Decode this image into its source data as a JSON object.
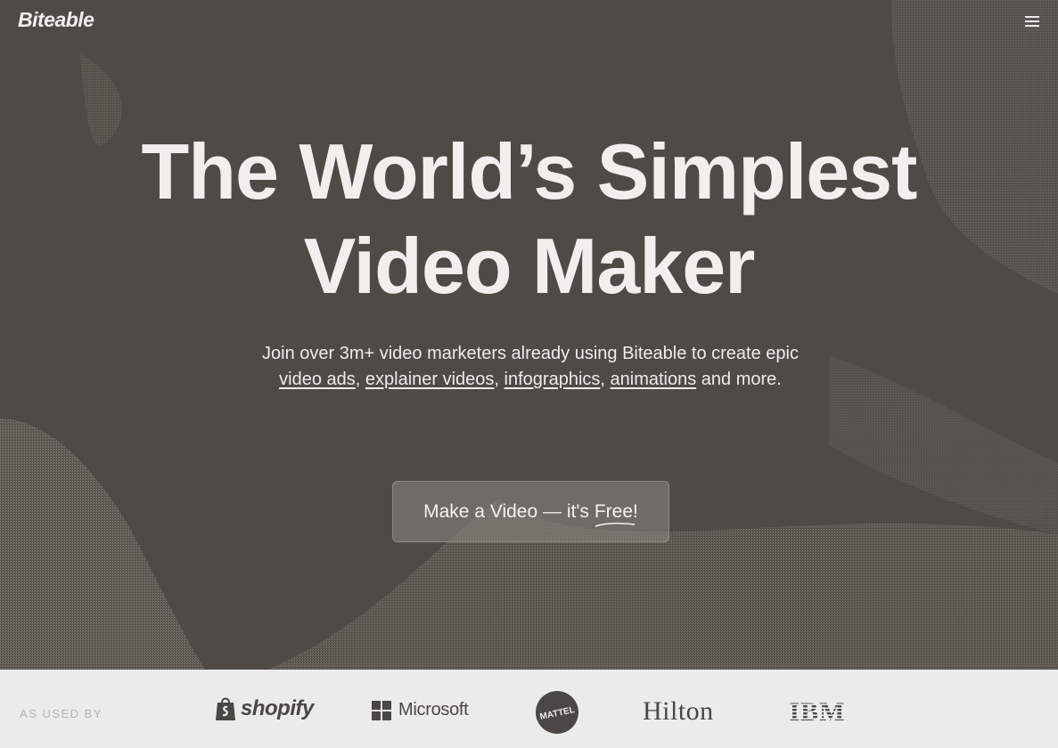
{
  "header": {
    "logo_text": "Biteable",
    "menu_icon": "hamburger-menu-icon"
  },
  "hero": {
    "headline_line1": "The World’s Simplest",
    "headline_line2": "Video Maker",
    "subtext": {
      "intro": "Join over 3m+ video marketers already using Biteable to create epic ",
      "link_video_ads": "video ads",
      "sep1": ", ",
      "link_explainer_videos": "explainer videos",
      "sep2": ", ",
      "link_infographics": "infographics",
      "sep3": ", ",
      "link_animations": "animations",
      "outro": " and more."
    },
    "cta": {
      "label_main": "Make a Video — it's",
      "label_free": "Free!"
    },
    "colors": {
      "background": "#4e4a45",
      "text": "#f1efed"
    }
  },
  "logos_bar": {
    "label": "AS USED BY",
    "brands": {
      "shopify": "shopify",
      "microsoft": "Microsoft",
      "mattel": "MATTEL",
      "hilton": "Hilton",
      "ibm": "IBM"
    },
    "colors": {
      "background": "#ebebeb",
      "logo": "#4a4744"
    }
  }
}
